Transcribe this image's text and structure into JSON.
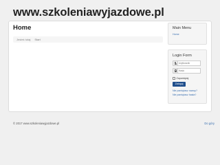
{
  "site": {
    "title": "www.szkoleniawyjazdowe.pl"
  },
  "page": {
    "heading": "Home",
    "breadcrumb": {
      "prefix": "Jesteś tutaj:",
      "current": "Start"
    }
  },
  "sidebar": {
    "menu": {
      "title": "Main Menu",
      "items": [
        {
          "label": "Home"
        }
      ]
    },
    "login": {
      "title": "Login Form",
      "username_placeholder": "Użytkownik",
      "password_placeholder": "Hasło",
      "remember_label": "Zapamiętaj",
      "submit_label": "Zaloguj",
      "forgot_username": "Nie pamiętasz nazwy?",
      "forgot_password": "Nie pamiętasz hasła?"
    }
  },
  "footer": {
    "copyright": "© 2017 www.szkoleniawyjazdowe.pl",
    "back_to_top": "Do góry"
  },
  "colors": {
    "accent": "#1f4e8c",
    "link": "#3a6fb0",
    "background": "#f0f0f0"
  },
  "icons": {
    "username": "user-icon",
    "password": "lock-icon"
  }
}
